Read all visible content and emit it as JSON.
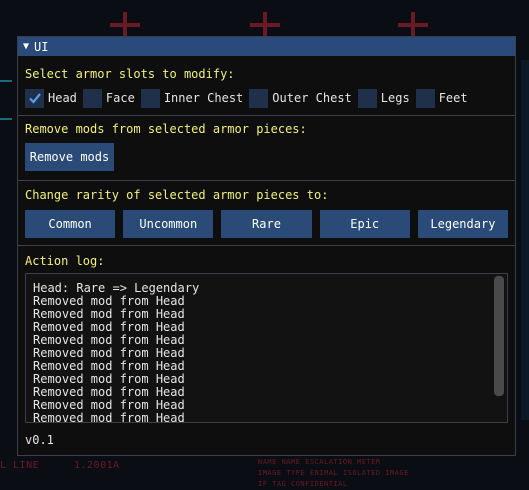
{
  "window": {
    "title": "UI"
  },
  "armor_slots": {
    "label": "Select armor slots to modify:",
    "items": [
      {
        "label": "Head",
        "checked": true
      },
      {
        "label": "Face",
        "checked": false
      },
      {
        "label": "Inner Chest",
        "checked": false
      },
      {
        "label": "Outer Chest",
        "checked": false
      },
      {
        "label": "Legs",
        "checked": false
      },
      {
        "label": "Feet",
        "checked": false
      }
    ]
  },
  "mods": {
    "label": "Remove mods from selected armor pieces:",
    "button": "Remove mods"
  },
  "rarity": {
    "label": "Change rarity of selected armor pieces to:",
    "buttons": [
      "Common",
      "Uncommon",
      "Rare",
      "Epic",
      "Legendary"
    ]
  },
  "log": {
    "label": "Action log:",
    "lines": [
      "Head: Rare => Legendary",
      "Removed mod from Head",
      "Removed mod from Head",
      "Removed mod from Head",
      "Removed mod from Head",
      "Removed mod from Head",
      "Removed mod from Head",
      "Removed mod from Head",
      "Removed mod from Head",
      "Removed mod from Head",
      "Removed mod from Head"
    ]
  },
  "version": "v0.1",
  "background": {
    "text_left": "L LINE",
    "text_left_value": "1.2001A",
    "text_right_1": "NAME NAME ESCALATION METER",
    "text_right_2": "IMAGE TYPE ENIMAL ISOLATED IMAGE",
    "text_right_3": "IF TAG CONFIDENTIAL"
  },
  "colors": {
    "accent": "#294a7a",
    "button": "#2a4a78",
    "section_label": "#f2f27a",
    "checkbox_bg": "#21304a"
  }
}
